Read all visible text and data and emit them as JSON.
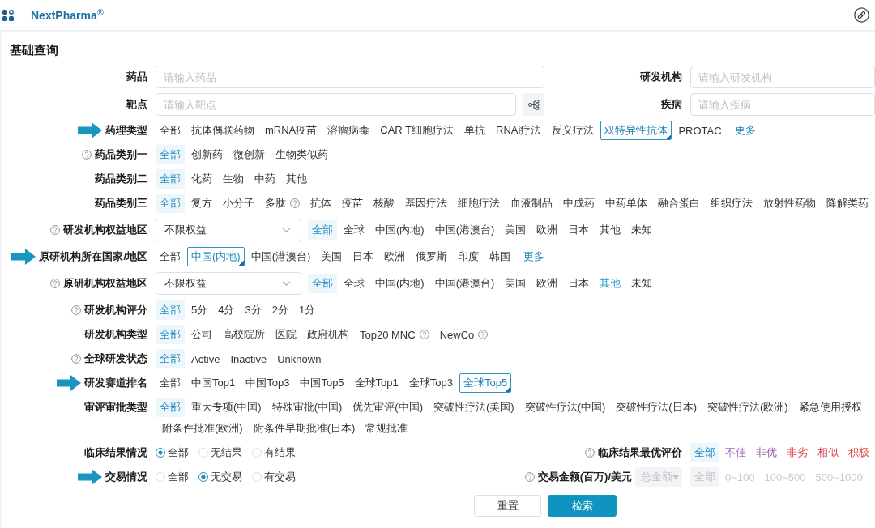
{
  "header": {
    "brand": "NextPharma$^{®}$"
  },
  "section_title": "基础查询",
  "rows": [
    {
      "kind": "inputs",
      "left": {
        "label": "药品",
        "placeholder": "请输入药品",
        "tree_button": false
      },
      "right": {
        "label": "研发机构",
        "placeholder": "请输入研发机构"
      }
    },
    {
      "kind": "inputs",
      "left": {
        "label": "靶点",
        "placeholder": "请输入靶点",
        "tree_button": true
      },
      "right": {
        "label": "疾病",
        "placeholder": "请输入疾病"
      }
    },
    {
      "kind": "outlined-options",
      "label": "药理类型",
      "help": false,
      "marked": true,
      "options": [
        {
          "label": "全部",
          "selected": false
        },
        {
          "label": "抗体偶联药物",
          "selected": false
        },
        {
          "label": "mRNA疫苗",
          "selected": false
        },
        {
          "label": "溶瘤病毒",
          "selected": false
        },
        {
          "label": "CAR T细胞疗法",
          "selected": false
        },
        {
          "label": "单抗",
          "selected": false
        },
        {
          "label": "RNAi疗法",
          "selected": false
        },
        {
          "label": "反义疗法",
          "selected": false
        },
        {
          "label": "双特异性抗体",
          "selected": true
        },
        {
          "label": "PROTAC",
          "selected": false
        }
      ],
      "more": "更多"
    },
    {
      "kind": "filled-options",
      "label": "药品类别一",
      "help": true,
      "marked": false,
      "options": [
        {
          "label": "全部",
          "selected": true
        },
        {
          "label": "创新药",
          "selected": false
        },
        {
          "label": "微创新",
          "selected": false
        },
        {
          "label": "生物类似药",
          "selected": false
        }
      ]
    },
    {
      "kind": "filled-options",
      "label": "药品类别二",
      "help": false,
      "marked": false,
      "options": [
        {
          "label": "全部",
          "selected": true
        },
        {
          "label": "化药",
          "selected": false
        },
        {
          "label": "生物",
          "selected": false
        },
        {
          "label": "中药",
          "selected": false
        },
        {
          "label": "其他",
          "selected": false
        }
      ]
    },
    {
      "kind": "filled-options",
      "label": "药品类别三",
      "help": false,
      "marked": false,
      "options": [
        {
          "label": "全部",
          "selected": true,
          "help": false
        },
        {
          "label": "复方",
          "selected": false,
          "help": false
        },
        {
          "label": "小分子",
          "selected": false,
          "help": false
        },
        {
          "label": "多肽",
          "selected": false,
          "help": true
        },
        {
          "label": "抗体",
          "selected": false,
          "help": false
        },
        {
          "label": "疫苗",
          "selected": false,
          "help": false
        },
        {
          "label": "核酸",
          "selected": false,
          "help": false
        },
        {
          "label": "基因疗法",
          "selected": false,
          "help": false
        },
        {
          "label": "细胞疗法",
          "selected": false,
          "help": false
        },
        {
          "label": "血液制品",
          "selected": false,
          "help": false
        },
        {
          "label": "中成药",
          "selected": false,
          "help": false
        },
        {
          "label": "中药单体",
          "selected": false,
          "help": false
        },
        {
          "label": "融合蛋白",
          "selected": false,
          "help": false
        },
        {
          "label": "组织疗法",
          "selected": false,
          "help": false
        },
        {
          "label": "放射性药物",
          "selected": false,
          "help": false
        },
        {
          "label": "降解类药",
          "selected": false,
          "help": false
        }
      ]
    },
    {
      "kind": "filled-options",
      "label": "研发机构权益地区",
      "help": true,
      "marked": false,
      "select": {
        "value": "不限权益"
      },
      "options": [
        {
          "label": "全部",
          "selected": true
        },
        {
          "label": "全球",
          "selected": false
        },
        {
          "label": "中国(内地)",
          "selected": false
        },
        {
          "label": "中国(港澳台)",
          "selected": false
        },
        {
          "label": "美国",
          "selected": false
        },
        {
          "label": "欧洲",
          "selected": false
        },
        {
          "label": "日本",
          "selected": false
        },
        {
          "label": "其他",
          "selected": false
        },
        {
          "label": "未知",
          "selected": false
        }
      ]
    },
    {
      "kind": "outlined-options",
      "label": "原研机构所在国家/地区",
      "help": false,
      "marked": true,
      "options": [
        {
          "label": "全部",
          "selected": false
        },
        {
          "label": "中国(内地)",
          "selected": true
        },
        {
          "label": "中国(港澳台)",
          "selected": false
        },
        {
          "label": "美国",
          "selected": false
        },
        {
          "label": "日本",
          "selected": false
        },
        {
          "label": "欧洲",
          "selected": false
        },
        {
          "label": "俄罗斯",
          "selected": false
        },
        {
          "label": "印度",
          "selected": false
        },
        {
          "label": "韩国",
          "selected": false
        }
      ],
      "more": "更多"
    },
    {
      "kind": "filled-options",
      "label": "原研机构权益地区",
      "help": true,
      "marked": false,
      "select": {
        "value": "不限权益"
      },
      "options": [
        {
          "label": "全部",
          "selected": true,
          "highlighted": false
        },
        {
          "label": "全球",
          "selected": false,
          "highlighted": false
        },
        {
          "label": "中国(内地)",
          "selected": false,
          "highlighted": false
        },
        {
          "label": "中国(港澳台)",
          "selected": false,
          "highlighted": false
        },
        {
          "label": "美国",
          "selected": false,
          "highlighted": false
        },
        {
          "label": "欧洲",
          "selected": false,
          "highlighted": false
        },
        {
          "label": "日本",
          "selected": false,
          "highlighted": false
        },
        {
          "label": "其他",
          "selected": false,
          "highlighted": true
        },
        {
          "label": "未知",
          "selected": false,
          "highlighted": false
        }
      ]
    },
    {
      "kind": "filled-options",
      "label": "研发机构评分",
      "help": true,
      "marked": false,
      "options": [
        {
          "label": "全部",
          "selected": true
        },
        {
          "label": "5分",
          "selected": false
        },
        {
          "label": "4分",
          "selected": false
        },
        {
          "label": "3分",
          "selected": false
        },
        {
          "label": "2分",
          "selected": false
        },
        {
          "label": "1分",
          "selected": false
        }
      ]
    },
    {
      "kind": "filled-options",
      "label": "研发机构类型",
      "help": false,
      "marked": false,
      "options": [
        {
          "label": "全部",
          "selected": true,
          "help": false
        },
        {
          "label": "公司",
          "selected": false,
          "help": false
        },
        {
          "label": "高校院所",
          "selected": false,
          "help": false
        },
        {
          "label": "医院",
          "selected": false,
          "help": false
        },
        {
          "label": "政府机构",
          "selected": false,
          "help": false
        },
        {
          "label": "Top20 MNC",
          "selected": false,
          "help": true
        },
        {
          "label": "NewCo",
          "selected": false,
          "help": true
        }
      ]
    },
    {
      "kind": "filled-options",
      "label": "全球研发状态",
      "help": true,
      "marked": false,
      "options": [
        {
          "label": "全部",
          "selected": true
        },
        {
          "label": "Active",
          "selected": false
        },
        {
          "label": "Inactive",
          "selected": false
        },
        {
          "label": "Unknown",
          "selected": false
        }
      ]
    },
    {
      "kind": "outlined-options",
      "label": "研发赛道排名",
      "help": false,
      "marked": true,
      "options": [
        {
          "label": "全部",
          "selected": false
        },
        {
          "label": "中国Top1",
          "selected": false
        },
        {
          "label": "中国Top3",
          "selected": false
        },
        {
          "label": "中国Top5",
          "selected": false
        },
        {
          "label": "全球Top1",
          "selected": false
        },
        {
          "label": "全球Top3",
          "selected": false
        },
        {
          "label": "全球Top5",
          "selected": true
        }
      ]
    },
    {
      "kind": "filled-options",
      "label": "审评审批类型",
      "help": false,
      "marked": false,
      "options": [
        {
          "label": "全部",
          "selected": true
        },
        {
          "label": "重大专项(中国)",
          "selected": false
        },
        {
          "label": "特殊审批(中国)",
          "selected": false
        },
        {
          "label": "优先审评(中国)",
          "selected": false
        },
        {
          "label": "突破性疗法(美国)",
          "selected": false
        },
        {
          "label": "突破性疗法(中国)",
          "selected": false
        },
        {
          "label": "突破性疗法(日本)",
          "selected": false
        },
        {
          "label": "突破性疗法(欧洲)",
          "selected": false
        },
        {
          "label": "紧急使用授权",
          "selected": false
        },
        {
          "label": "附条件批准(欧洲)",
          "selected": false
        },
        {
          "label": "附条件早期批准(日本)",
          "selected": false
        },
        {
          "label": "常规批准",
          "selected": false
        }
      ]
    },
    {
      "kind": "radios",
      "label": "临床结果情况",
      "marked": false,
      "radios": [
        {
          "label": "全部",
          "selected": true
        },
        {
          "label": "无结果",
          "selected": false
        },
        {
          "label": "有结果",
          "selected": false
        }
      ],
      "right": {
        "label": "临床结果最优评价",
        "help": true,
        "options": [
          {
            "label": "全部",
            "selected": true
          },
          {
            "label": "不佳",
            "selected": false,
            "color": "#a374c4"
          },
          {
            "label": "非优",
            "selected": false,
            "color": "#8c5aa8"
          },
          {
            "label": "非劣",
            "selected": false,
            "color": "#e2464f"
          },
          {
            "label": "相似",
            "selected": false,
            "color": "#d9424f"
          },
          {
            "label": "积极",
            "selected": false,
            "color": "#e0504a"
          }
        ]
      }
    },
    {
      "kind": "radios",
      "label": "交易情况",
      "marked": true,
      "radios": [
        {
          "label": "全部",
          "selected": false
        },
        {
          "label": "无交易",
          "selected": true
        },
        {
          "label": "有交易",
          "selected": false
        }
      ],
      "right": {
        "label": "交易金额(百万)/美元",
        "help": true,
        "select": {
          "value": "总金额",
          "disabled": true
        },
        "disabled": true,
        "options": [
          {
            "label": "全部",
            "selected": true
          },
          {
            "label": "0~100",
            "selected": false
          },
          {
            "label": "100~500",
            "selected": false
          },
          {
            "label": "500~1000",
            "selected": false
          }
        ]
      }
    }
  ],
  "buttons": [
    {
      "label": "重置",
      "kind": "secondary"
    },
    {
      "label": "检索",
      "kind": "primary"
    }
  ]
}
